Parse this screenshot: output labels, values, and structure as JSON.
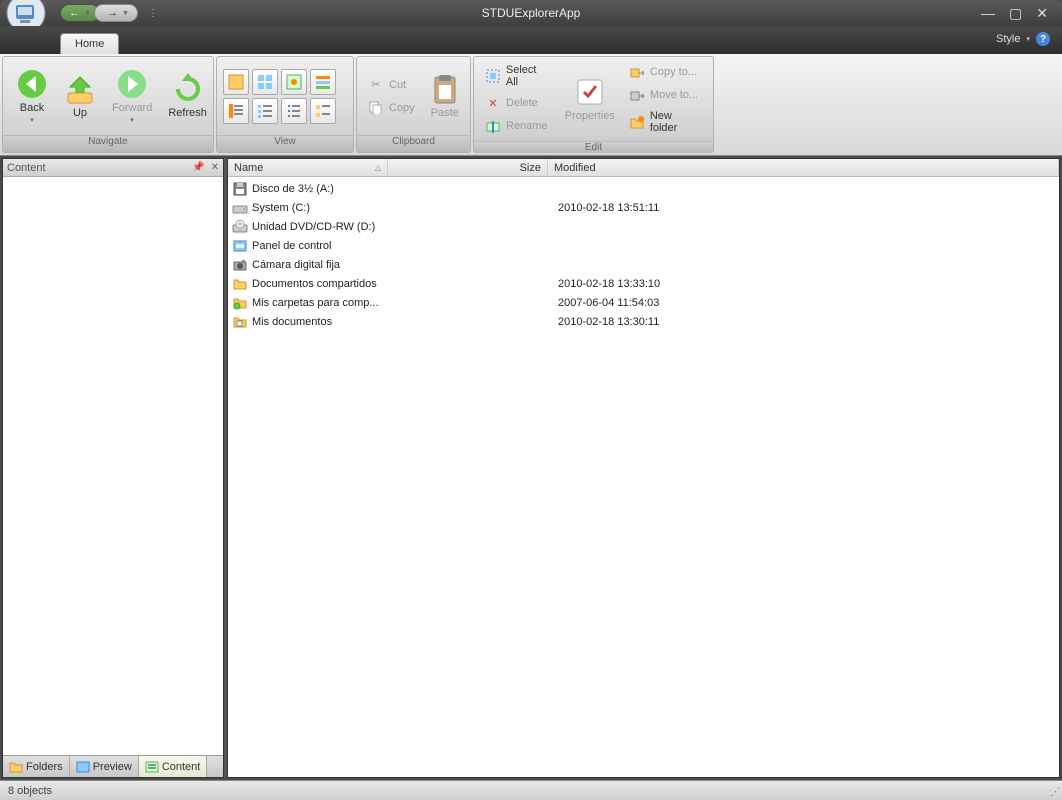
{
  "app": {
    "title": "STDUExplorerApp",
    "style_label": "Style"
  },
  "tabs": {
    "home": "Home"
  },
  "ribbon": {
    "navigate": {
      "title": "Navigate",
      "back": "Back",
      "up": "Up",
      "forward": "Forward",
      "refresh": "Refresh"
    },
    "view": {
      "title": "View"
    },
    "clipboard": {
      "title": "Clipboard",
      "cut": "Cut",
      "copy": "Copy",
      "paste": "Paste"
    },
    "edit": {
      "title": "Edit",
      "select_all": "Select All",
      "delete": "Delete",
      "rename": "Rename",
      "properties": "Properties",
      "copy_to": "Copy to...",
      "move_to": "Move to...",
      "new_folder": "New folder"
    }
  },
  "side": {
    "header": "Content",
    "tabs": {
      "folders": "Folders",
      "preview": "Preview",
      "content": "Content"
    }
  },
  "columns": {
    "name": "Name",
    "size": "Size",
    "modified": "Modified"
  },
  "files": [
    {
      "icon": "floppy",
      "name": "Disco de 3½ (A:)",
      "size": "",
      "modified": ""
    },
    {
      "icon": "drive",
      "name": "System (C:)",
      "size": "",
      "modified": "2010-02-18 13:51:11"
    },
    {
      "icon": "dvd",
      "name": "Unidad DVD/CD-RW (D:)",
      "size": "",
      "modified": ""
    },
    {
      "icon": "control",
      "name": "Panel de control",
      "size": "",
      "modified": ""
    },
    {
      "icon": "camera",
      "name": "Cámara digital fija",
      "size": "",
      "modified": ""
    },
    {
      "icon": "folder",
      "name": "Documentos compartidos",
      "size": "",
      "modified": "2010-02-18 13:33:10"
    },
    {
      "icon": "netfolder",
      "name": "Mis carpetas para comp...",
      "size": "",
      "modified": "2007-06-04 11:54:03"
    },
    {
      "icon": "docs",
      "name": "Mis documentos",
      "size": "",
      "modified": "2010-02-18 13:30:11"
    }
  ],
  "status": {
    "text": "8 objects"
  }
}
